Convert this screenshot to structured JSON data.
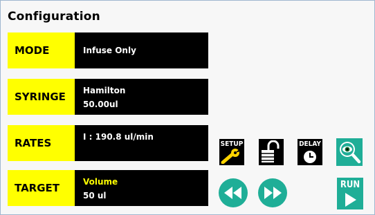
{
  "header": {
    "title": "Configuration"
  },
  "rows": [
    {
      "label": "MODE",
      "line1": "Infuse Only",
      "line2": ""
    },
    {
      "label": "SYRINGE",
      "line1": "Hamilton",
      "line2": "50.00ul"
    },
    {
      "label": "RATES",
      "line1": "I : 190.8 ul/min",
      "line2": ""
    },
    {
      "label": "TARGET",
      "line1": "Volume",
      "line2": "50 ul"
    }
  ],
  "buttons": {
    "setup_label": "SETUP",
    "delay_label": "DELAY",
    "run_label": "RUN"
  },
  "icons": {
    "setup": "wrench-icon",
    "unlock": "unlock-icon",
    "delay": "clock-icon",
    "view": "eye-magnifier-icon",
    "rewind": "rewind-icon",
    "fast_forward": "fast-forward-icon",
    "run": "play-icon"
  },
  "colors": {
    "label_bg": "#ffff00",
    "panel_bg": "#000000",
    "teal": "#1fae97",
    "target_text": "#ffff00"
  }
}
